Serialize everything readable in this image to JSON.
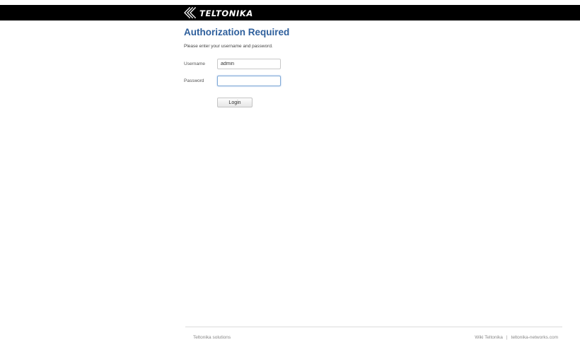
{
  "header": {
    "brand": "TELTONIKA",
    "background": "#000000"
  },
  "auth": {
    "title": "Authorization Required",
    "description": "Please enter your username and password.",
    "username_label": "Username",
    "username_value": "admin",
    "password_label": "Password",
    "password_value": "",
    "login_label": "Login"
  },
  "footer": {
    "left_text": "Teltonika solutions",
    "link_wiki": "Wiki Teltonika",
    "separator": "|",
    "link_site": "teltonika-networks.com"
  },
  "colors": {
    "title": "#2e5f9c"
  },
  "icons": {
    "logo": "teltonika-logo-icon"
  }
}
